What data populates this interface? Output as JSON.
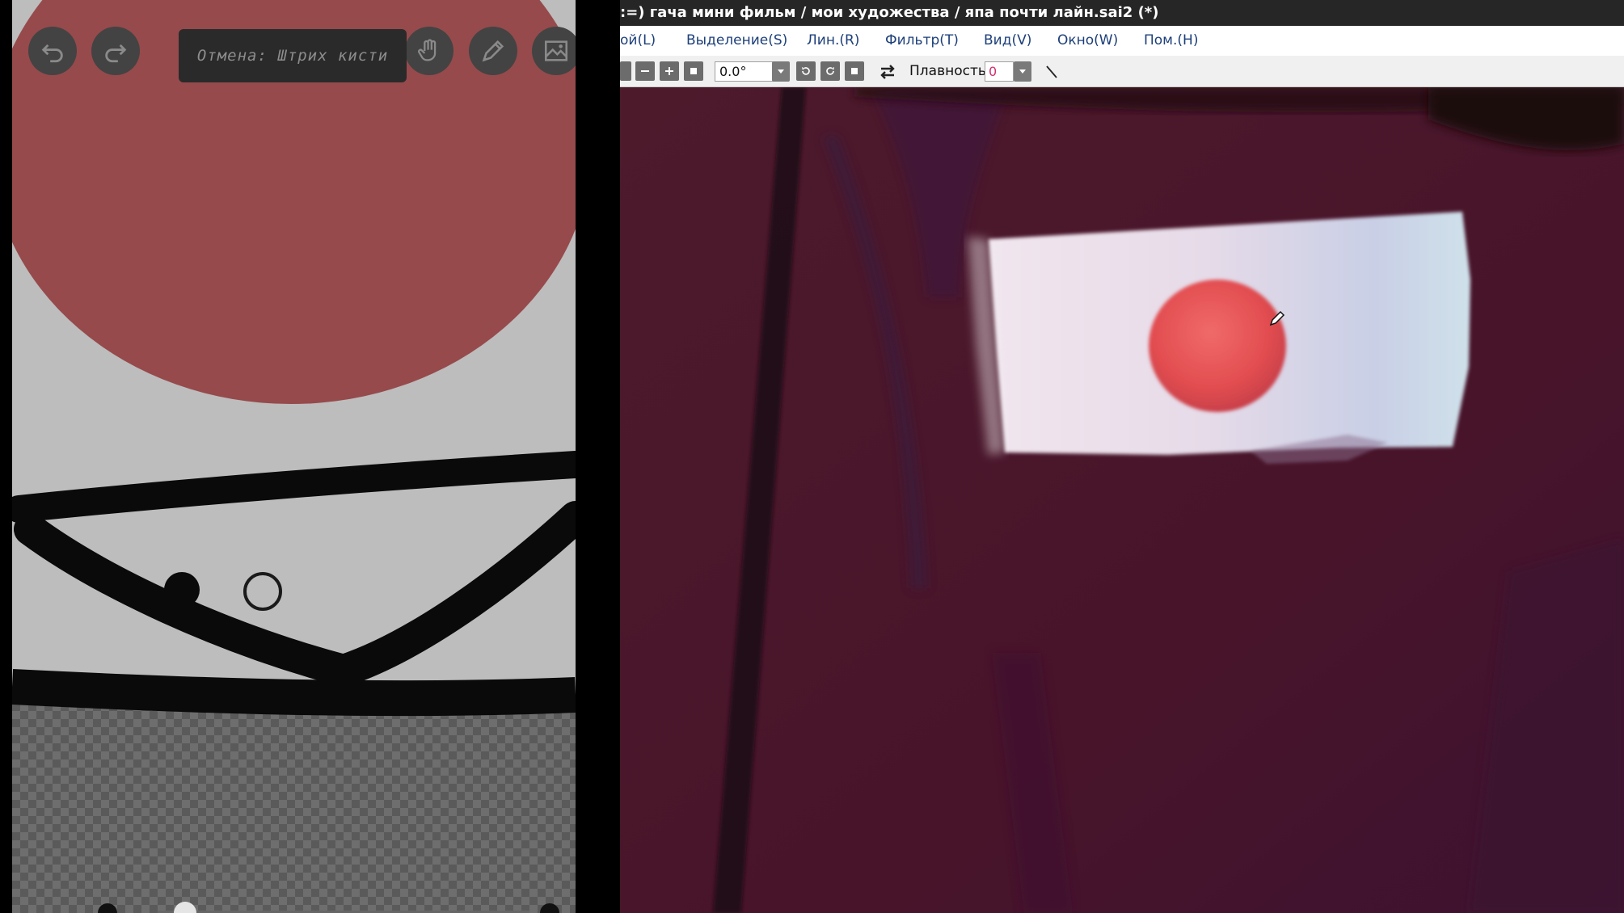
{
  "left_app": {
    "tooltip": "Отмена: Штрих кисти",
    "toolbar": {
      "icons": [
        "undo-icon",
        "redo-icon",
        "hand-icon",
        "pencil-icon",
        "image-icon"
      ]
    }
  },
  "sai": {
    "title": ":=) гача мини фильм / мои художества / япа почти лайн.sai2 (*)",
    "menu": [
      "ой(L)",
      "Выделение(S)",
      "Лин.(R)",
      "Фильтр(T)",
      "Вид(V)",
      "Окно(W)",
      "Пом.(H)"
    ],
    "toolbar": {
      "rotation_value": "0.0°",
      "smoothing_label": "Плавность",
      "smoothing_value": "0"
    }
  },
  "colors": {
    "canvas_bg": "#4a1428",
    "window_title_bg": "#262626",
    "left_canvas_bg": "#bdbdbd",
    "red_shape": "#964a4c",
    "eye_highlight": "#e55556"
  }
}
